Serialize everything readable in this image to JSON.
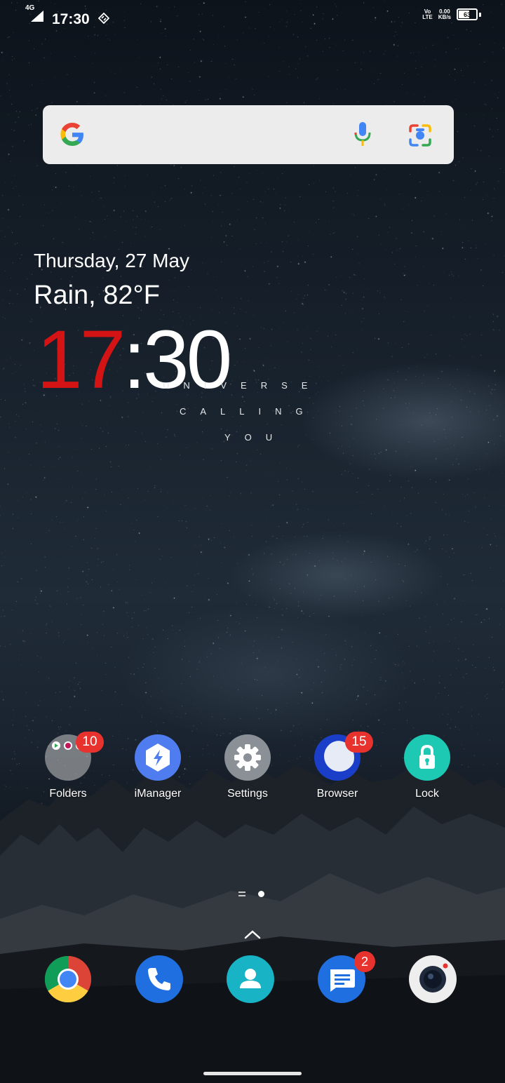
{
  "status_bar": {
    "network_type": "4G",
    "time": "17:30",
    "volte_top": "Vo",
    "volte_bottom": "LTE",
    "speed_value": "0.00",
    "speed_unit": "KB/s",
    "battery_level": "63",
    "battery_fraction": 0.63
  },
  "search": {
    "logo_icon": "google-g-icon",
    "mic_icon": "microphone-icon",
    "lens_icon": "google-lens-icon"
  },
  "clock_widget": {
    "date": "Thursday, 27 May",
    "weather": "Rain, 82°F",
    "hours": "17",
    "rest": ":30",
    "hours_color": "#d41414"
  },
  "wallpaper_quote": [
    "UNIVERSE",
    "CALLING",
    "YOU"
  ],
  "apps": [
    {
      "label": "Folders",
      "badge": "10",
      "icon": "folder-icon"
    },
    {
      "label": "iManager",
      "badge": "",
      "icon": "lightning-icon"
    },
    {
      "label": "Settings",
      "badge": "",
      "icon": "gear-icon"
    },
    {
      "label": "Browser",
      "badge": "15",
      "icon": "browser-icon"
    },
    {
      "label": "Lock",
      "badge": "",
      "icon": "padlock-icon"
    }
  ],
  "dock": [
    {
      "icon": "chrome-icon",
      "badge": ""
    },
    {
      "icon": "phone-icon",
      "badge": ""
    },
    {
      "icon": "contacts-icon",
      "badge": ""
    },
    {
      "icon": "messages-icon",
      "badge": "2"
    },
    {
      "icon": "camera-icon",
      "badge": ""
    }
  ],
  "colors": {
    "badge": "#e8322e",
    "search_bg": "#ececec"
  }
}
